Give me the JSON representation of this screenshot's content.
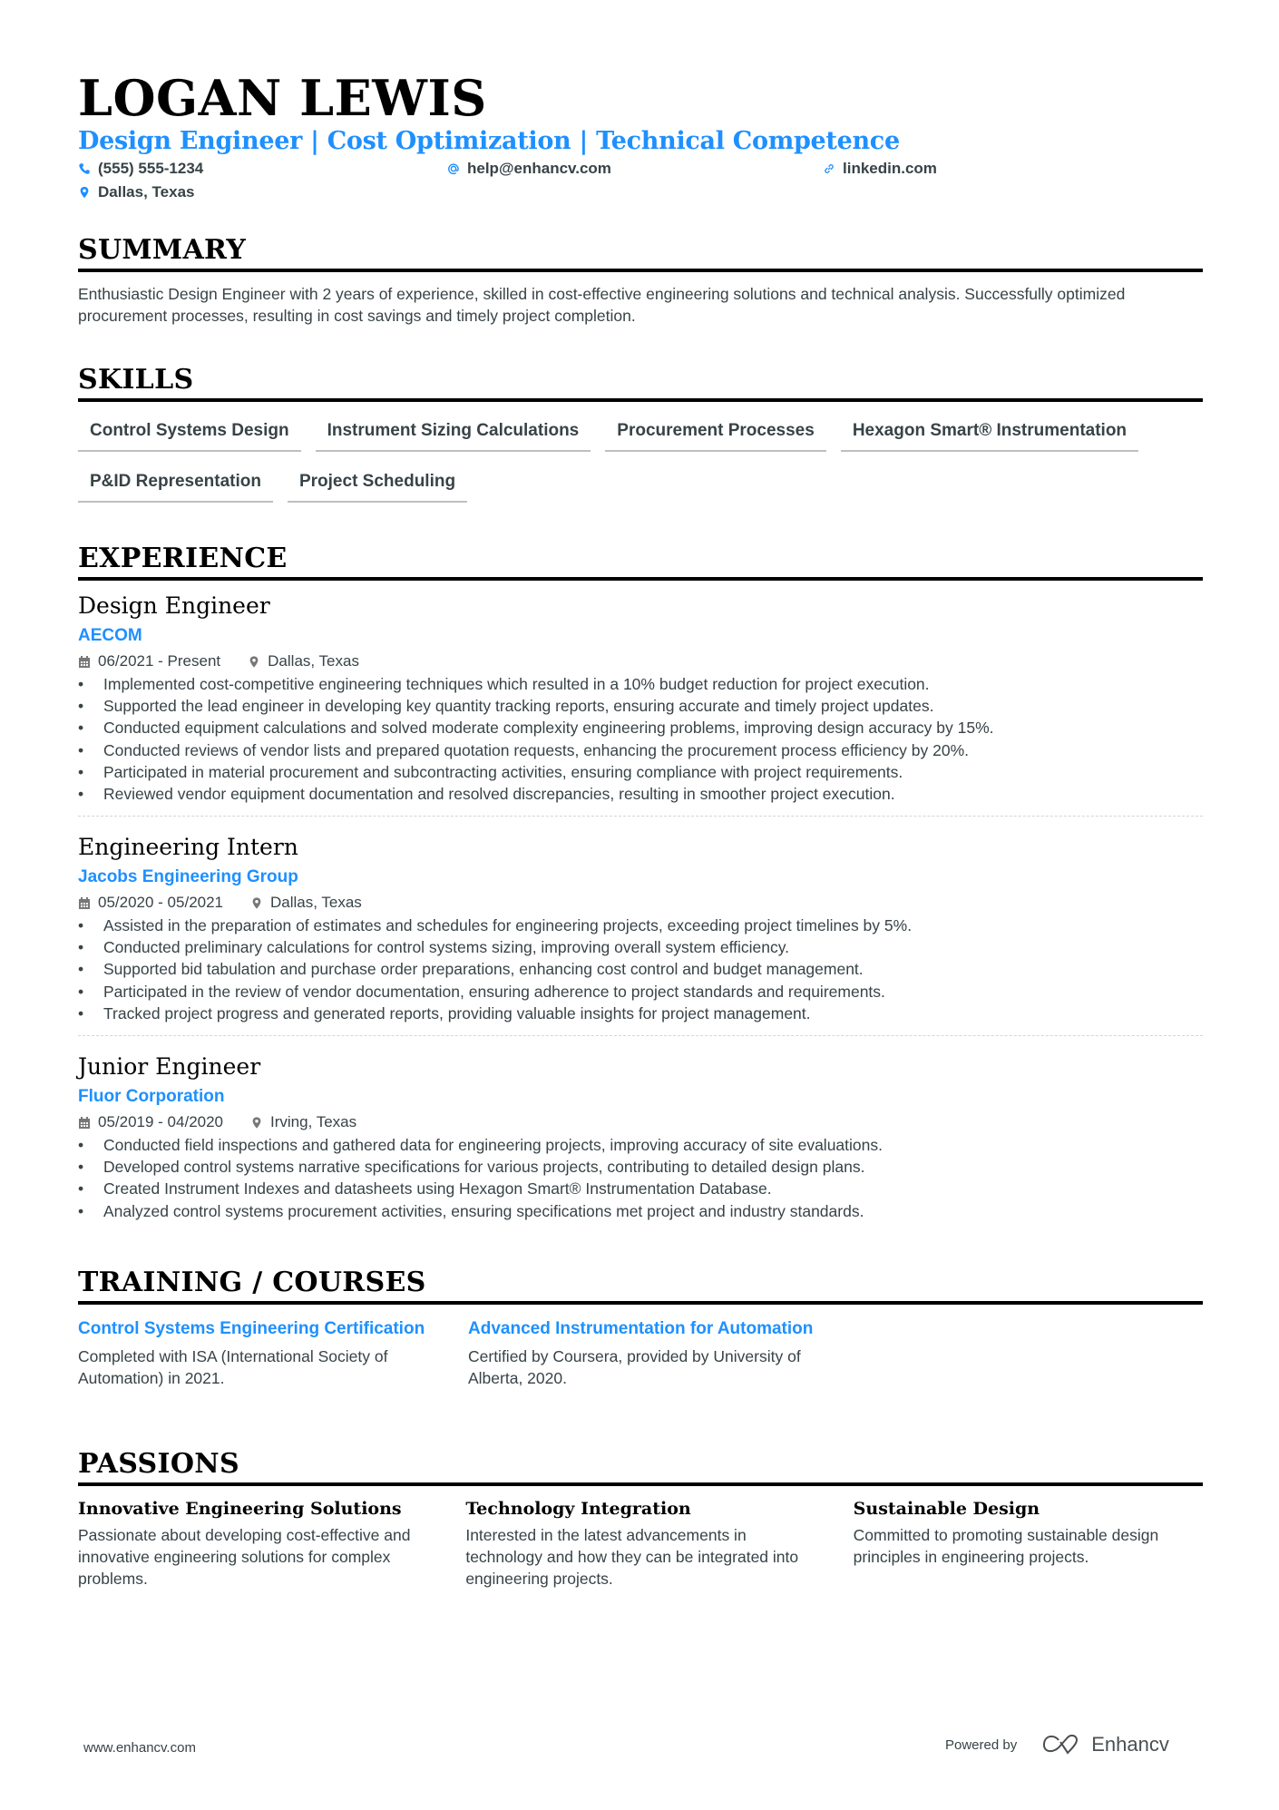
{
  "header": {
    "name": "LOGAN LEWIS",
    "headline": "Design Engineer | Cost Optimization | Technical Competence",
    "phone": "(555) 555-1234",
    "email": "help@enhancv.com",
    "linkedin": "linkedin.com",
    "location": "Dallas, Texas"
  },
  "colors": {
    "accent": "#1e90ff",
    "text": "#384347",
    "heading": "#000000"
  },
  "summary": {
    "title": "SUMMARY",
    "text": "Enthusiastic Design Engineer with 2 years of experience, skilled in cost-effective engineering solutions and technical analysis. Successfully optimized procurement processes, resulting in cost savings and timely project completion."
  },
  "skills": {
    "title": "SKILLS",
    "items": [
      "Control Systems Design",
      "Instrument Sizing Calculations",
      "Procurement Processes",
      "Hexagon Smart® Instrumentation",
      "P&ID Representation",
      "Project Scheduling"
    ]
  },
  "experience": {
    "title": "EXPERIENCE",
    "jobs": [
      {
        "title": "Design Engineer",
        "company": "AECOM",
        "dates": "06/2021 - Present",
        "location": "Dallas, Texas",
        "bullets": [
          "Implemented cost-competitive engineering techniques which resulted in a 10% budget reduction for project execution.",
          "Supported the lead engineer in developing key quantity tracking reports, ensuring accurate and timely project updates.",
          "Conducted equipment calculations and solved moderate complexity engineering problems, improving design accuracy by 15%.",
          "Conducted reviews of vendor lists and prepared quotation requests, enhancing the procurement process efficiency by 20%.",
          "Participated in material procurement and subcontracting activities, ensuring compliance with project requirements.",
          "Reviewed vendor equipment documentation and resolved discrepancies, resulting in smoother project execution."
        ]
      },
      {
        "title": "Engineering Intern",
        "company": "Jacobs Engineering Group",
        "dates": "05/2020 - 05/2021",
        "location": "Dallas, Texas",
        "bullets": [
          "Assisted in the preparation of estimates and schedules for engineering projects, exceeding project timelines by 5%.",
          "Conducted preliminary calculations for control systems sizing, improving overall system efficiency.",
          "Supported bid tabulation and purchase order preparations, enhancing cost control and budget management.",
          "Participated in the review of vendor documentation, ensuring adherence to project standards and requirements.",
          "Tracked project progress and generated reports, providing valuable insights for project management."
        ]
      },
      {
        "title": "Junior Engineer",
        "company": "Fluor Corporation",
        "dates": "05/2019 - 04/2020",
        "location": "Irving, Texas",
        "bullets": [
          "Conducted field inspections and gathered data for engineering projects, improving accuracy of site evaluations.",
          "Developed control systems narrative specifications for various projects, contributing to detailed design plans.",
          "Created Instrument Indexes and datasheets using Hexagon Smart® Instrumentation Database.",
          "Analyzed control systems procurement activities, ensuring specifications met project and industry standards."
        ]
      }
    ]
  },
  "training": {
    "title": "TRAINING / COURSES",
    "items": [
      {
        "title": "Control Systems Engineering Certification",
        "description": "Completed with ISA (International Society of Automation) in 2021."
      },
      {
        "title": "Advanced Instrumentation for Automation",
        "description": "Certified by Coursera, provided by University of Alberta, 2020."
      }
    ]
  },
  "passions": {
    "title": "PASSIONS",
    "items": [
      {
        "title": "Innovative Engineering Solutions",
        "description": "Passionate about developing cost-effective and innovative engineering solutions for complex problems."
      },
      {
        "title": "Technology Integration",
        "description": "Interested in the latest advancements in technology and how they can be integrated into engineering projects."
      },
      {
        "title": "Sustainable Design",
        "description": "Committed to promoting sustainable design principles in engineering projects."
      }
    ]
  },
  "footer": {
    "website": "www.enhancv.com",
    "powered_by": "Powered by",
    "brand": "Enhancv"
  },
  "icons": {
    "phone": "phone-icon",
    "email": "at-icon",
    "linkedin": "link-icon",
    "location": "map-pin-icon",
    "date": "calendar-icon",
    "logo": "enhancv-logo-icon"
  }
}
